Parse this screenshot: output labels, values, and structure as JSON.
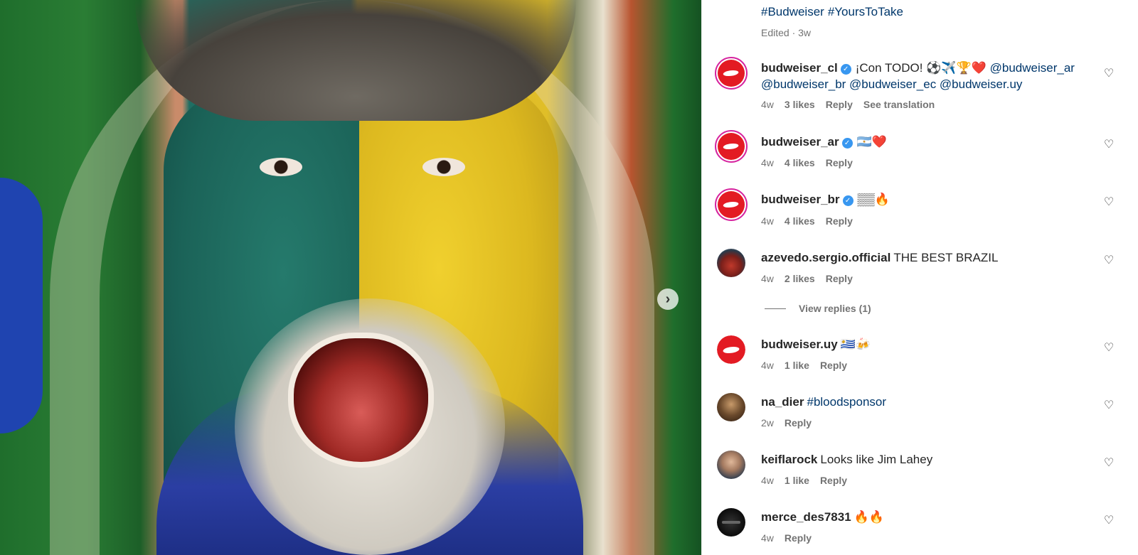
{
  "media": {
    "description_icon": "photo",
    "next_icon": "chevron-right-icon"
  },
  "caption": {
    "hashtags": [
      "#Budweiser",
      "#YoursToTake"
    ],
    "meta": "Edited · 3w"
  },
  "comments": [
    {
      "username": "budweiser_cl",
      "verified": true,
      "text": "¡Con TODO! ⚽️✈️🏆❤️",
      "mentions_line1": "@budweiser_ar",
      "mentions_line2": "@budweiser_br @budweiser_ec @budweiser.uy",
      "time": "4w",
      "likes": "3 likes",
      "reply": "Reply",
      "translation": "See translation"
    },
    {
      "username": "budweiser_ar",
      "verified": true,
      "text": "🇦🇷❤️",
      "time": "4w",
      "likes": "4 likes",
      "reply": "Reply"
    },
    {
      "username": "budweiser_br",
      "verified": true,
      "text": "▒▒🔥",
      "time": "4w",
      "likes": "4 likes",
      "reply": "Reply"
    },
    {
      "username": "azevedo.sergio.official",
      "verified": false,
      "text": "THE BEST BRAZIL",
      "time": "4w",
      "likes": "2 likes",
      "reply": "Reply",
      "view_replies": "View replies (1)"
    },
    {
      "username": "budweiser.uy",
      "verified": false,
      "text": "🇺🇾🍻",
      "time": "4w",
      "likes": "1 like",
      "reply": "Reply"
    },
    {
      "username": "na_dier",
      "verified": false,
      "text": "#bloodsponsor",
      "time": "2w",
      "reply": "Reply"
    },
    {
      "username": "keiflarock",
      "verified": false,
      "text": "Looks like Jim Lahey",
      "time": "4w",
      "likes": "1 like",
      "reply": "Reply"
    },
    {
      "username": "merce_des7831",
      "verified": false,
      "text": "🔥🔥",
      "time": "4w",
      "reply": "Reply"
    }
  ],
  "colors": {
    "link": "#00376b",
    "muted": "#737373",
    "verified": "#3897f0",
    "budweiser_red": "#e31b23"
  }
}
